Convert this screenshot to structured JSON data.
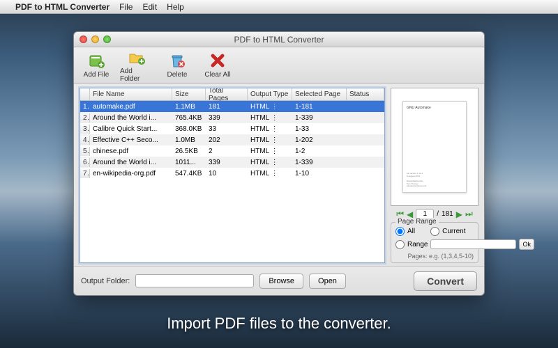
{
  "menubar": {
    "app_name": "PDF to HTML Converter",
    "items": [
      "File",
      "Edit",
      "Help"
    ]
  },
  "window": {
    "title": "PDF to HTML Converter",
    "toolbar": {
      "add_file": "Add File",
      "add_folder": "Add Folder",
      "delete": "Delete",
      "clear_all": "Clear All"
    }
  },
  "table": {
    "headers": {
      "name": "File Name",
      "size": "Size",
      "pages": "Total Pages",
      "type": "Output Type",
      "sel": "Selected Page",
      "status": "Status"
    },
    "rows": [
      {
        "idx": "1",
        "name": "automake.pdf",
        "size": "1.1MB",
        "pages": "181",
        "type": "HTML",
        "sel": "1-181",
        "selected": true
      },
      {
        "idx": "2",
        "name": "Around the World i...",
        "size": "765.4KB",
        "pages": "339",
        "type": "HTML",
        "sel": "1-339"
      },
      {
        "idx": "3",
        "name": "Calibre Quick Start...",
        "size": "368.0KB",
        "pages": "33",
        "type": "HTML",
        "sel": "1-33"
      },
      {
        "idx": "4",
        "name": "Effective C++ Seco...",
        "size": "1.0MB",
        "pages": "202",
        "type": "HTML",
        "sel": "1-202"
      },
      {
        "idx": "5",
        "name": "chinese.pdf",
        "size": "26.5KB",
        "pages": "2",
        "type": "HTML",
        "sel": "1-2"
      },
      {
        "idx": "6",
        "name": "Around the World i...",
        "size": "1011...",
        "pages": "339",
        "type": "HTML",
        "sel": "1-339"
      },
      {
        "idx": "7",
        "name": "en-wikipedia-org.pdf",
        "size": "547.4KB",
        "pages": "10",
        "type": "HTML",
        "sel": "1-10"
      }
    ]
  },
  "preview": {
    "headline": "GNU Automake",
    "current": "1",
    "total": "181",
    "sep": "/"
  },
  "page_range": {
    "legend": "Page Range",
    "all": "All",
    "current": "Current",
    "range": "Range",
    "ok": "Ok",
    "hint": "Pages: e.g. (1,3,4,5-10)",
    "value": ""
  },
  "footer": {
    "output_label": "Output Folder:",
    "output_value": "",
    "browse": "Browse",
    "open": "Open",
    "convert": "Convert"
  },
  "caption": "Import PDF files to the converter."
}
